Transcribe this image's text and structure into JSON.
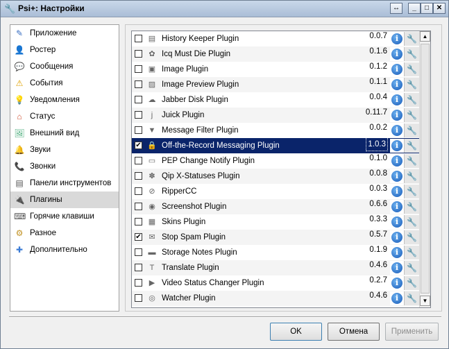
{
  "window": {
    "title": "Psi+: Настройки",
    "controls": {
      "restore": "↔",
      "minimize": "_",
      "maximize": "□",
      "close": "✕"
    }
  },
  "sidebar": {
    "items": [
      {
        "label": "Приложение",
        "icon": "app-icon",
        "glyph": "✎",
        "color": "#3a6fc2"
      },
      {
        "label": "Ростер",
        "icon": "roster-icon",
        "glyph": "👤",
        "color": "#444"
      },
      {
        "label": "Сообщения",
        "icon": "messages-icon",
        "glyph": "💬",
        "color": "#3a7bd5"
      },
      {
        "label": "События",
        "icon": "events-icon",
        "glyph": "⚠",
        "color": "#e0a100"
      },
      {
        "label": "Уведомления",
        "icon": "notifications-icon",
        "glyph": "💡",
        "color": "#e3c200"
      },
      {
        "label": "Статус",
        "icon": "status-icon",
        "glyph": "⌂",
        "color": "#d05030"
      },
      {
        "label": "Внешний вид",
        "icon": "appearance-icon",
        "glyph": "🖼",
        "color": "#4a7"
      },
      {
        "label": "Звуки",
        "icon": "sounds-icon",
        "glyph": "🔔",
        "color": "#c08020"
      },
      {
        "label": "Звонки",
        "icon": "calls-icon",
        "glyph": "📞",
        "color": "#c03020"
      },
      {
        "label": "Панели инструментов",
        "icon": "toolbars-icon",
        "glyph": "▤",
        "color": "#555"
      },
      {
        "label": "Плагины",
        "icon": "plugins-icon",
        "glyph": "🔌",
        "color": "#333"
      },
      {
        "label": "Горячие клавиши",
        "icon": "hotkeys-icon",
        "glyph": "⌨",
        "color": "#555"
      },
      {
        "label": "Разное",
        "icon": "misc-icon",
        "glyph": "⚙",
        "color": "#c09020"
      },
      {
        "label": "Дополнительно",
        "icon": "advanced-icon",
        "glyph": "✚",
        "color": "#3a7bd5"
      }
    ],
    "selected_index": 10
  },
  "plugins": [
    {
      "name": "History Keeper Plugin",
      "version": "0.0.7",
      "checked": false,
      "icon": "history-icon",
      "glyph": "▤"
    },
    {
      "name": "Icq Must Die Plugin",
      "version": "0.1.6",
      "checked": false,
      "icon": "icq-icon",
      "glyph": "✿"
    },
    {
      "name": "Image Plugin",
      "version": "0.1.2",
      "checked": false,
      "icon": "image-icon",
      "glyph": "▣"
    },
    {
      "name": "Image Preview Plugin",
      "version": "0.1.1",
      "checked": false,
      "icon": "image-preview-icon",
      "glyph": "▨"
    },
    {
      "name": "Jabber Disk Plugin",
      "version": "0.0.4",
      "checked": false,
      "icon": "disk-icon",
      "glyph": "☁"
    },
    {
      "name": "Juick Plugin",
      "version": "0.11.7",
      "checked": false,
      "icon": "juick-icon",
      "glyph": "j"
    },
    {
      "name": "Message Filter Plugin",
      "version": "0.0.2",
      "checked": false,
      "icon": "filter-icon",
      "glyph": "▼"
    },
    {
      "name": "Off-the-Record Messaging Plugin",
      "version": "1.0.3",
      "checked": true,
      "icon": "otr-icon",
      "glyph": "🔒"
    },
    {
      "name": "PEP Change Notify Plugin",
      "version": "0.1.0",
      "checked": false,
      "icon": "pep-icon",
      "glyph": "▭"
    },
    {
      "name": "Qip X-Statuses Plugin",
      "version": "0.0.8",
      "checked": false,
      "icon": "qip-icon",
      "glyph": "✽"
    },
    {
      "name": "RipperCC",
      "version": "0.0.3",
      "checked": false,
      "icon": "ripper-icon",
      "glyph": "⊘"
    },
    {
      "name": "Screenshot Plugin",
      "version": "0.6.6",
      "checked": false,
      "icon": "screenshot-icon",
      "glyph": "◉"
    },
    {
      "name": "Skins Plugin",
      "version": "0.3.3",
      "checked": false,
      "icon": "skins-icon",
      "glyph": "▦"
    },
    {
      "name": "Stop Spam Plugin",
      "version": "0.5.7",
      "checked": true,
      "icon": "stop-spam-icon",
      "glyph": "✉"
    },
    {
      "name": "Storage Notes Plugin",
      "version": "0.1.9",
      "checked": false,
      "icon": "notes-icon",
      "glyph": "▬"
    },
    {
      "name": "Translate Plugin",
      "version": "0.4.6",
      "checked": false,
      "icon": "translate-icon",
      "glyph": "T"
    },
    {
      "name": "Video Status Changer Plugin",
      "version": "0.2.7",
      "checked": false,
      "icon": "video-icon",
      "glyph": "▶"
    },
    {
      "name": "Watcher Plugin",
      "version": "0.4.6",
      "checked": false,
      "icon": "watcher-icon",
      "glyph": "◎"
    }
  ],
  "selected_plugin_index": 7,
  "info_glyph": "i",
  "settings_glyph": "🔧",
  "buttons": {
    "ok": "OK",
    "cancel": "Отмена",
    "apply": "Применить"
  }
}
